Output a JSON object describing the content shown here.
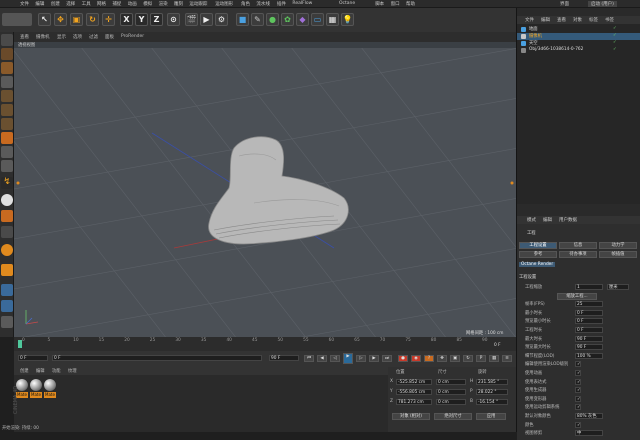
{
  "menubar": {
    "items": [
      "文件",
      "编辑",
      "创建",
      "选择",
      "工具",
      "网格",
      "捕捉",
      "动画",
      "模拟",
      "渲染",
      "雕刻",
      "运动跟踪",
      "运动图形",
      "角色",
      "流水线",
      "插件",
      "RealFlow",
      "Octane",
      "脚本",
      "窗口",
      "帮助"
    ],
    "layout_label": "界面",
    "layout_value": "启动 (用户)"
  },
  "toolbar": {
    "axis_x": "X",
    "axis_y": "Y",
    "axis_z": "Z"
  },
  "viewport": {
    "menu": [
      "查看",
      "摄像机",
      "显示",
      "选项",
      "过滤",
      "面板",
      "ProRender"
    ],
    "title": "透视视图",
    "grid_label": "网格间距 : 100 cm"
  },
  "objects": {
    "tabs": [
      "文件",
      "编辑",
      "查看",
      "对象",
      "标签",
      "书签"
    ],
    "items": [
      {
        "name": "地面"
      },
      {
        "name": "摄像机"
      },
      {
        "name": "天空"
      },
      {
        "name": "Obj/3d66-1038614-0-762"
      }
    ]
  },
  "attributes": {
    "tabs": [
      "模式",
      "编辑",
      "用户数据"
    ],
    "title": "工程",
    "subtabs": [
      "工程设置",
      "信息",
      "动力学",
      "参考",
      "待办事项",
      "帧插值"
    ],
    "extra_tab": "Octane Render",
    "section": "工程设置",
    "rows": [
      {
        "label": "工程缩放",
        "value": "1",
        "unit": "厘米"
      },
      {
        "label": "缩放工程..."
      },
      {
        "label": "帧率(FPS)",
        "value": "25"
      },
      {
        "label": "最小时长",
        "value": "0 F"
      },
      {
        "label": "预览最小时长",
        "value": "0 F"
      },
      {
        "label": "工程时长",
        "value": "0 F"
      },
      {
        "label": "最大时长",
        "value": "90 F"
      },
      {
        "label": "预览最大时长",
        "value": "90 F"
      },
      {
        "label": "细节程度(LOD)",
        "value": "100 %"
      },
      {
        "label": "编辑使用渲染LOD级别"
      },
      {
        "label": "使用动画"
      },
      {
        "label": "使用表达式"
      },
      {
        "label": "使用生成器"
      },
      {
        "label": "使用变形器"
      },
      {
        "label": "使用运动剪辑系统"
      },
      {
        "label": "默认对象颜色",
        "value": "80% 灰色"
      },
      {
        "label": "颜色"
      },
      {
        "label": "视图修剪",
        "value": "中"
      }
    ]
  },
  "timeline": {
    "ticks": [
      "0",
      "5",
      "10",
      "15",
      "20",
      "25",
      "30",
      "35",
      "40",
      "45",
      "50",
      "55",
      "60",
      "65",
      "70",
      "75",
      "80",
      "85",
      "90"
    ],
    "current_frame": "0 F",
    "start": "0 F",
    "end": "90 F",
    "end2": "90 F"
  },
  "materials": {
    "tabs": [
      "创建",
      "编辑",
      "功能",
      "纹理"
    ],
    "items": [
      "Mate",
      "Mate",
      "Mate"
    ],
    "watermark": "CINEMA 4D"
  },
  "coords": {
    "headers": [
      "位置",
      "尺寸",
      "旋转"
    ],
    "rows": [
      {
        "axis": "X",
        "pos": "-525.852 cm",
        "size": "0 cm",
        "rot_axis": "H",
        "rot": "231.585 °"
      },
      {
        "axis": "Y",
        "pos": "-556.805 cm",
        "size": "0 cm",
        "rot_axis": "P",
        "rot": "28.022 °"
      },
      {
        "axis": "Z",
        "pos": "781.273 cm",
        "size": "0 cm",
        "rot_axis": "B",
        "rot": "-16.154 °"
      }
    ],
    "mode": "对象 (相对)",
    "size_mode": "绝对尺寸",
    "apply": "应用"
  },
  "status": {
    "text": "开始渲染: 持续: 00"
  },
  "colors": {
    "accent": "#e08a1e",
    "viewport_bg": "#4b5056",
    "selected": "#345a7a"
  }
}
